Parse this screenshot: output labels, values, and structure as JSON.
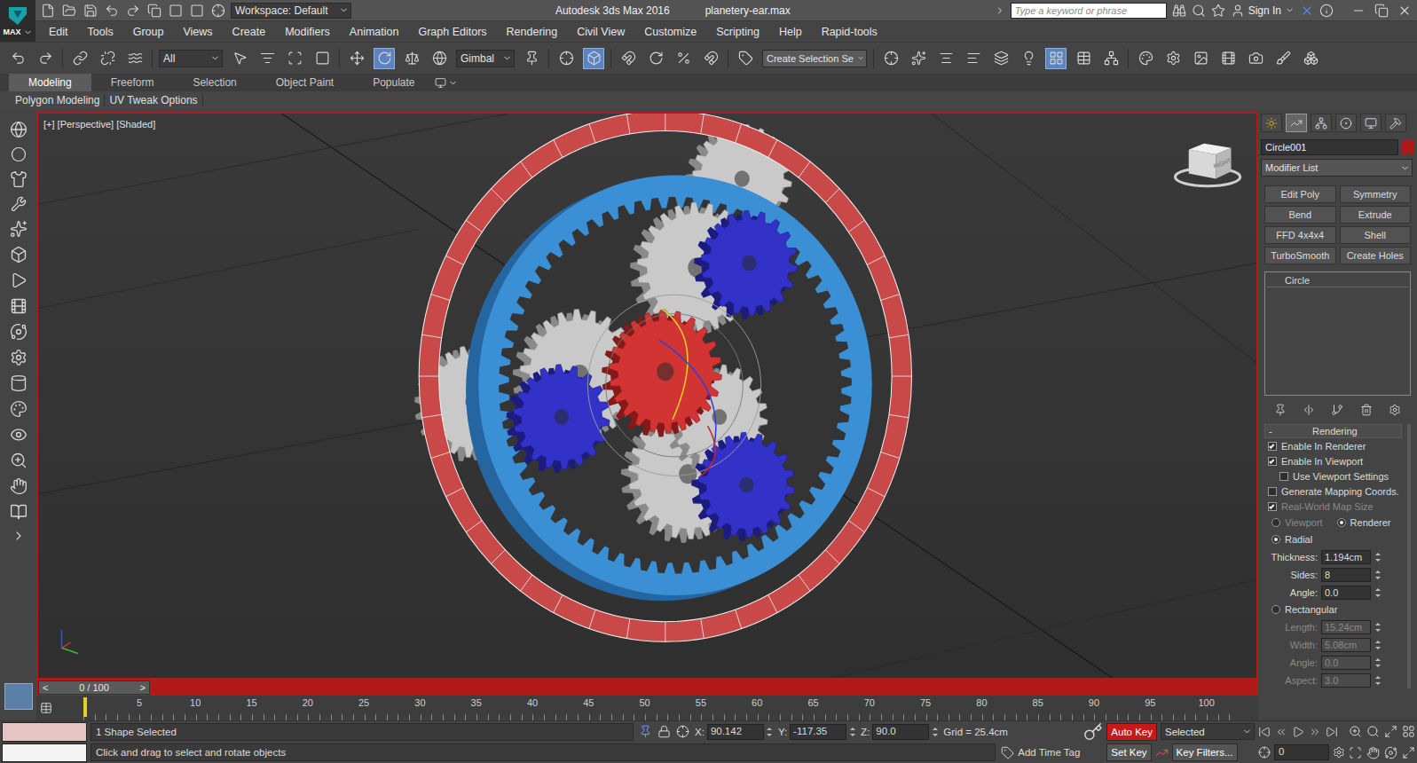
{
  "titleBar": {
    "logo": "MAX",
    "workspace": "Workspace: Default",
    "title": "Autodesk 3ds Max 2016",
    "file": "planetery-ear.max",
    "search": {
      "placeholder": "Type a keyword or phrase"
    },
    "signIn": "Sign In"
  },
  "menu": [
    "Edit",
    "Tools",
    "Group",
    "Views",
    "Create",
    "Modifiers",
    "Animation",
    "Graph Editors",
    "Rendering",
    "Civil View",
    "Customize",
    "Scripting",
    "Help",
    "Rapid-tools"
  ],
  "mainToolbar": {
    "selectionFilter": "All",
    "refCoordSystem": "Gimbal",
    "namedSelection": "Create Selection Se"
  },
  "ribbon": {
    "tabs": [
      {
        "label": "Modeling",
        "selected": true
      },
      {
        "label": "Freeform",
        "selected": false
      },
      {
        "label": "Selection",
        "selected": false
      },
      {
        "label": "Object Paint",
        "selected": false
      },
      {
        "label": "Populate",
        "selected": false
      }
    ],
    "panels": [
      "Polygon Modeling",
      "UV Tweak Options"
    ]
  },
  "viewport": {
    "label": "[+] [Perspective] [Shaded]",
    "viewCube": "RIGHT"
  },
  "commandPanel": {
    "tabs": [
      {
        "name": "create",
        "selected": false
      },
      {
        "name": "modify",
        "selected": true
      },
      {
        "name": "hierarchy",
        "selected": false
      },
      {
        "name": "motion",
        "selected": false
      },
      {
        "name": "display",
        "selected": false
      },
      {
        "name": "utilities",
        "selected": false
      }
    ],
    "objectName": "Circle001",
    "objectColor": "#b01818",
    "modifierList": "Modifier List",
    "modifierButtons": [
      "Edit Poly",
      "Symmetry",
      "Bend",
      "Extrude",
      "FFD 4x4x4",
      "Shell",
      "TurboSmooth",
      "Create Holes"
    ],
    "stack": [
      {
        "label": "Circle",
        "selected": false
      }
    ],
    "rollout": {
      "title": "Rendering",
      "toggle": "-",
      "checkboxes": [
        {
          "label": "Enable In Renderer",
          "checked": true,
          "disabled": false
        },
        {
          "label": "Enable In Viewport",
          "checked": true,
          "disabled": false
        },
        {
          "label": "Use Viewport Settings",
          "checked": false,
          "disabled": false
        },
        {
          "label": "Generate Mapping Coords.",
          "checked": false,
          "disabled": false
        },
        {
          "label": "Real-World Map Size",
          "checked": true,
          "disabled": true
        }
      ],
      "mode": [
        {
          "label": "Viewport",
          "selected": false
        },
        {
          "label": "Renderer",
          "selected": true
        }
      ],
      "profiles": [
        {
          "label": "Radial",
          "selected": true,
          "fields": [
            {
              "label": "Thickness:",
              "value": "1.194cm"
            },
            {
              "label": "Sides:",
              "value": "8"
            },
            {
              "label": "Angle:",
              "value": "0.0"
            }
          ]
        },
        {
          "label": "Rectangular",
          "selected": false,
          "fields": [
            {
              "label": "Length:",
              "value": "15.24cm"
            },
            {
              "label": "Width:",
              "value": "5.08cm"
            },
            {
              "label": "Angle:",
              "value": "0.0"
            },
            {
              "label": "Aspect:",
              "value": "3.0"
            }
          ]
        }
      ]
    }
  },
  "timeSlider": {
    "reading": "0 / 100",
    "prev": "<",
    "next": ">",
    "level": 0
  },
  "trackBar": {
    "ticks": [
      "5",
      "10",
      "15",
      "20",
      "25",
      "30",
      "35",
      "40",
      "45",
      "50",
      "55",
      "60",
      "65",
      "70",
      "75",
      "80",
      "85",
      "90",
      "95",
      "100"
    ]
  },
  "status": {
    "selection": "1 Shape Selected",
    "prompt": "Click and drag to select and rotate objects",
    "coords": [
      {
        "axis": "X:",
        "value": "90.142"
      },
      {
        "axis": "Y:",
        "value": "-117.35"
      },
      {
        "axis": "Z:",
        "value": "90.0"
      }
    ],
    "grid": "Grid = 25.4cm",
    "addTimeTag": "Add Time Tag"
  },
  "animation": {
    "autoKey": {
      "label": "Auto Key",
      "on": true
    },
    "setKey": "Set Key",
    "keyMode": "Selected",
    "keyFilters": "Key Filters...",
    "frame": "0"
  }
}
